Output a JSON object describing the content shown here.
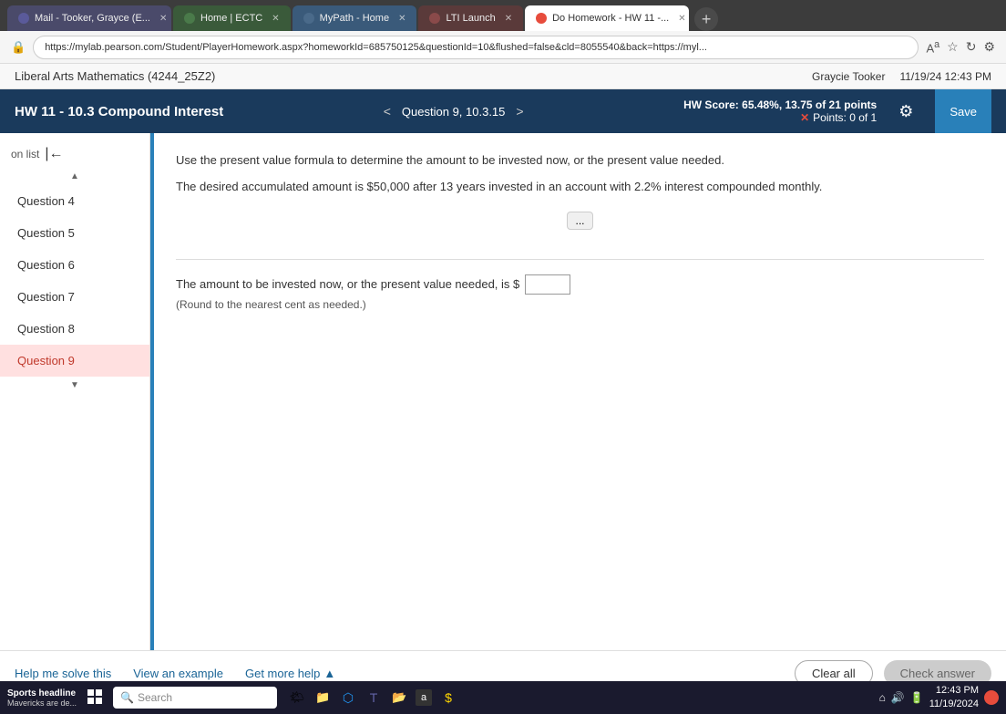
{
  "browser": {
    "tabs": [
      {
        "id": "mail",
        "label": "Mail - Tooker, Grayce (E...",
        "active": false,
        "color": "#5a5a9a"
      },
      {
        "id": "home",
        "label": "Home | ECTC",
        "active": false,
        "color": "#4a7a4a"
      },
      {
        "id": "mypath",
        "label": "MyPath - Home",
        "active": false,
        "color": "#4a6a8a"
      },
      {
        "id": "lti",
        "label": "LTI Launch",
        "active": false,
        "color": "#8a4a4a"
      },
      {
        "id": "homework",
        "label": "Do Homework - HW 11 -...",
        "active": true,
        "color": "#fff"
      }
    ],
    "address": "https://mylab.pearson.com/Student/PlayerHomework.aspx?homeworkId=685750125&questionId=10&flushed=false&cld=8055540&back=https://myl...",
    "new_tab_label": "+"
  },
  "course": {
    "title": "Liberal Arts Mathematics (4244_25Z2)",
    "user": "Graycie Tooker",
    "datetime": "11/19/24 12:43 PM"
  },
  "hw_header": {
    "title": "HW 11 - 10.3 Compound Interest",
    "nav_prev": "<",
    "nav_next": ">",
    "question_label": "Question 9, 10.3.15",
    "score_label": "HW Score:",
    "score_value": "65.48%, 13.75 of 21 points",
    "points_label": "Points: 0 of 1",
    "save_label": "Save"
  },
  "sidebar": {
    "items": [
      {
        "label": "Question 4",
        "active": false
      },
      {
        "label": "Question 5",
        "active": false
      },
      {
        "label": "Question 6",
        "active": false
      },
      {
        "label": "Question 7",
        "active": false
      },
      {
        "label": "Question 8",
        "active": false
      },
      {
        "label": "Question 9",
        "active": true
      }
    ]
  },
  "question": {
    "instruction": "Use the present value formula to determine the amount to be invested now, or the present value needed.",
    "detail": "The desired accumulated amount is $50,000 after 13 years invested in an account with 2.2% interest compounded monthly.",
    "expand_label": "...",
    "answer_prefix": "The amount to be invested now, or the present value needed, is $",
    "answer_placeholder": "",
    "round_note": "(Round to the nearest cent as needed.)"
  },
  "bottom_bar": {
    "help_me_label": "Help me solve this",
    "view_example_label": "View an example",
    "get_more_help_label": "Get more help",
    "get_more_help_arrow": "▲",
    "clear_all_label": "Clear all",
    "check_answer_label": "Check answer"
  },
  "taskbar": {
    "news_title": "Sports headline",
    "news_sub": "Mavericks are de...",
    "search_placeholder": "Search",
    "time": "12:43 PM",
    "date": "11/19/2024"
  }
}
